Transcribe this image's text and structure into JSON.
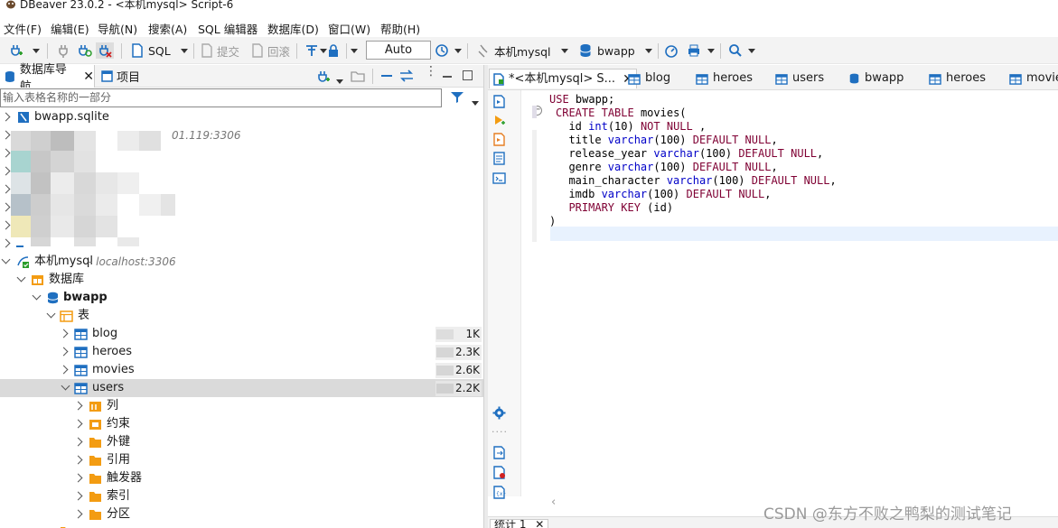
{
  "titlebar": {
    "title": "DBeaver 23.0.2 - <本机mysql> Script-6"
  },
  "menu": [
    "文件(F)",
    "编辑(E)",
    "导航(N)",
    "搜索(A)",
    "SQL 编辑器",
    "数据库(D)",
    "窗口(W)",
    "帮助(H)"
  ],
  "toolbar": {
    "sql_label": "SQL",
    "commit_label": "提交",
    "rollback_label": "回滚",
    "autocommit_value": "Auto",
    "connection_label": "本机mysql",
    "database_label": "bwapp"
  },
  "nav_panel": {
    "tab_navigator": "数据库导航",
    "tab_projects": "项目",
    "filter_placeholder": "输入表格名称的一部分"
  },
  "tree": {
    "sqlite_conn": "bwapp.sqlite",
    "blurred_host": "01.119:3306",
    "mysql_conn": "本机mysql",
    "mysql_host": " - localhost:3306",
    "databases": "数据库",
    "db_name": "bwapp",
    "tables_folder": "表",
    "tables": [
      {
        "name": "blog",
        "size": "1K"
      },
      {
        "name": "heroes",
        "size": "2.3K"
      },
      {
        "name": "movies",
        "size": "2.6K"
      },
      {
        "name": "users",
        "size": "2.2K"
      }
    ],
    "children": [
      "列",
      "约束",
      "外键",
      "引用",
      "触发器",
      "索引",
      "分区"
    ]
  },
  "editor": {
    "active_tab": "*<本机mysql> S...",
    "tabs": [
      "blog",
      "heroes",
      "users",
      "bwapp",
      "heroes",
      "movie"
    ],
    "code_lines": [
      "USE bwapp;",
      "CREATE TABLE movies(",
      "  id int(10) NOT NULL ,",
      "  title varchar(100) DEFAULT NULL,",
      "  release_year varchar(100) DEFAULT NULL,",
      "  genre varchar(100) DEFAULT NULL,",
      "  main_character varchar(100) DEFAULT NULL,",
      "  imdb varchar(100) DEFAULT NULL,",
      "  PRIMARY KEY (id)",
      ")"
    ],
    "results_tab": "统计 1"
  },
  "watermark": "CSDN @东方不败之鸭梨的测试笔记",
  "colors": {
    "keyword": "#7f0033",
    "type": "#0000c8",
    "table_icon": "#1f6fc0",
    "folder_icon": "#f39c12"
  }
}
